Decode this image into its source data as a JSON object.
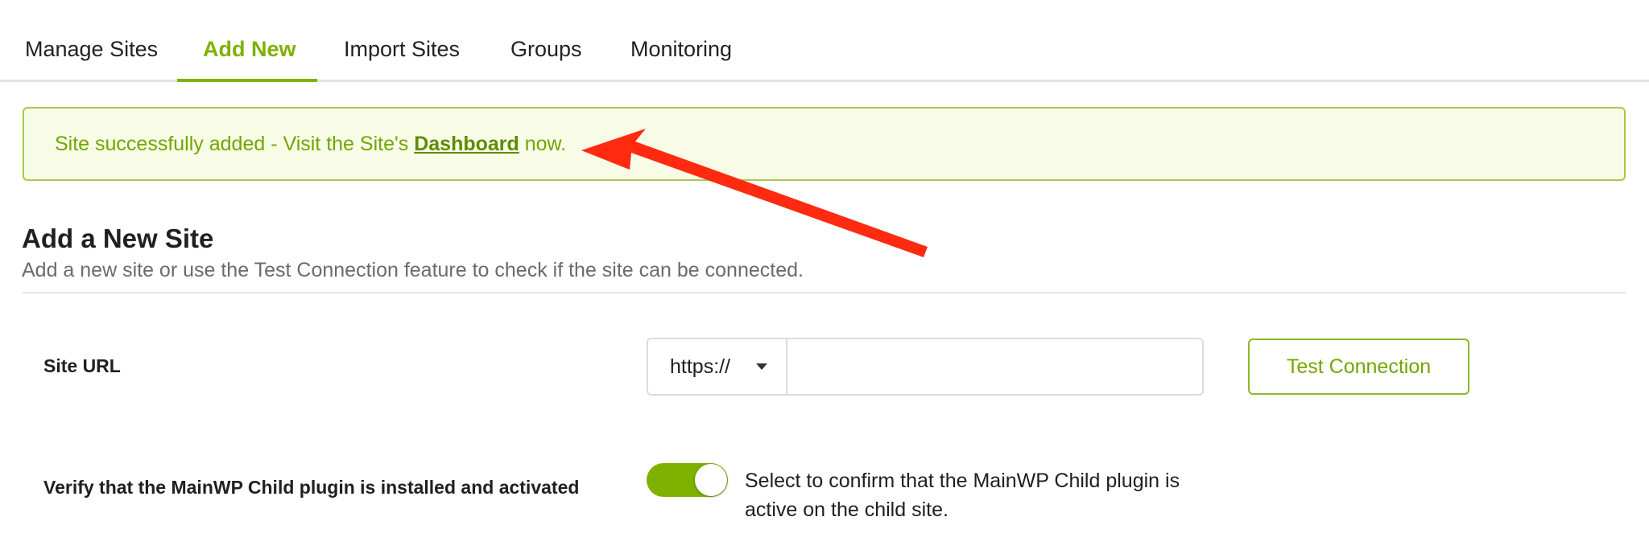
{
  "tabs": [
    {
      "label": "Manage Sites",
      "active": false
    },
    {
      "label": "Add New",
      "active": true
    },
    {
      "label": "Import Sites",
      "active": false
    },
    {
      "label": "Groups",
      "active": false
    },
    {
      "label": "Monitoring",
      "active": false
    }
  ],
  "notice": {
    "prefix": "Site successfully added - Visit the Site's ",
    "link": "Dashboard",
    "suffix": " now."
  },
  "heading": {
    "title": "Add a New Site",
    "subtitle": "Add a new site or use the Test Connection feature to check if the site can be connected."
  },
  "form": {
    "site_url_label": "Site URL",
    "protocol": "https://",
    "url_value": "",
    "test_button": "Test Connection",
    "verify_label": "Verify that the MainWP Child plugin is installed and activated",
    "verify_toggle_on": true,
    "verify_description": "Select to confirm that the MainWP Child plugin is active on the child site."
  },
  "colors": {
    "accent": "#7fb100",
    "notice_bg": "#f8fbe6",
    "notice_border": "#a7c94f",
    "annotation_arrow": "#ff2a10"
  },
  "icons": {
    "protocol_dropdown": "caret-down-icon",
    "annotation": "annotation-arrow-icon"
  }
}
